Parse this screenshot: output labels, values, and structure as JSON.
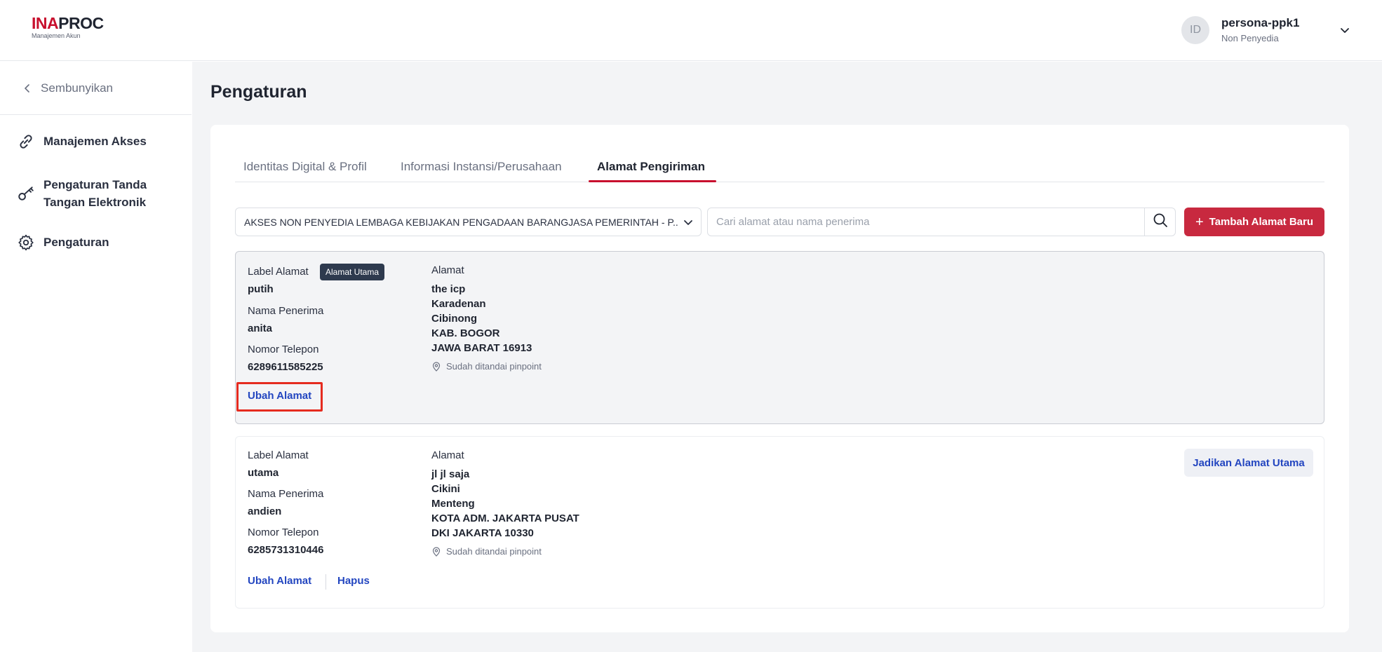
{
  "app": {
    "logo_prefix": "INA",
    "logo_suffix": "PROC",
    "logo_subtitle": "Manajemen Akun"
  },
  "user": {
    "initials": "ID",
    "name": "persona-ppk1",
    "role": "Non Penyedia"
  },
  "sidebar": {
    "hide_label": "Sembunyikan",
    "items": [
      {
        "label": "Manajemen Akses",
        "icon": "link-icon"
      },
      {
        "label": "Pengaturan Tanda Tangan Elektronik",
        "icon": "key-icon"
      },
      {
        "label": "Pengaturan",
        "icon": "gear-icon"
      }
    ]
  },
  "page": {
    "title": "Pengaturan"
  },
  "tabs": [
    {
      "label": "Identitas Digital & Profil",
      "active": false
    },
    {
      "label": "Informasi Instansi/Perusahaan",
      "active": false
    },
    {
      "label": "Alamat Pengiriman",
      "active": true
    }
  ],
  "toolbar": {
    "organization_selected": "AKSES NON PENYEDIA LEMBAGA KEBIJAKAN PENGADAAN BARANGJASA PEMERINTAH - P...",
    "search_placeholder": "Cari alamat atau nama penerima",
    "add_button_label": "Tambah Alamat Baru"
  },
  "field_labels": {
    "label_alamat": "Label Alamat",
    "nama_penerima": "Nama Penerima",
    "nomor_telepon": "Nomor Telepon",
    "alamat": "Alamat"
  },
  "addresses": [
    {
      "label": "putih",
      "is_primary": true,
      "primary_badge": "Alamat Utama",
      "recipient": "anita",
      "phone": "6289611585225",
      "address_lines": [
        "the icp",
        "Karadenan",
        "Cibinong",
        "KAB. BOGOR",
        "JAWA BARAT 16913"
      ],
      "pinpoint_text": "Sudah ditandai pinpoint",
      "edit_label": "Ubah Alamat"
    },
    {
      "label": "utama",
      "is_primary": false,
      "recipient": "andien",
      "phone": "6285731310446",
      "address_lines": [
        "jl jl saja",
        "Cikini",
        "Menteng",
        "KOTA ADM. JAKARTA PUSAT",
        "DKI JAKARTA 10330"
      ],
      "pinpoint_text": "Sudah ditandai pinpoint",
      "edit_label": "Ubah Alamat",
      "delete_label": "Hapus",
      "make_primary_label": "Jadikan Alamat Utama"
    }
  ],
  "colors": {
    "brand_red": "#c8102e",
    "button_red": "#c8293f",
    "link_blue": "#2346c0",
    "highlight_red": "#e52b1f",
    "badge_dark": "#2e3a4e"
  }
}
